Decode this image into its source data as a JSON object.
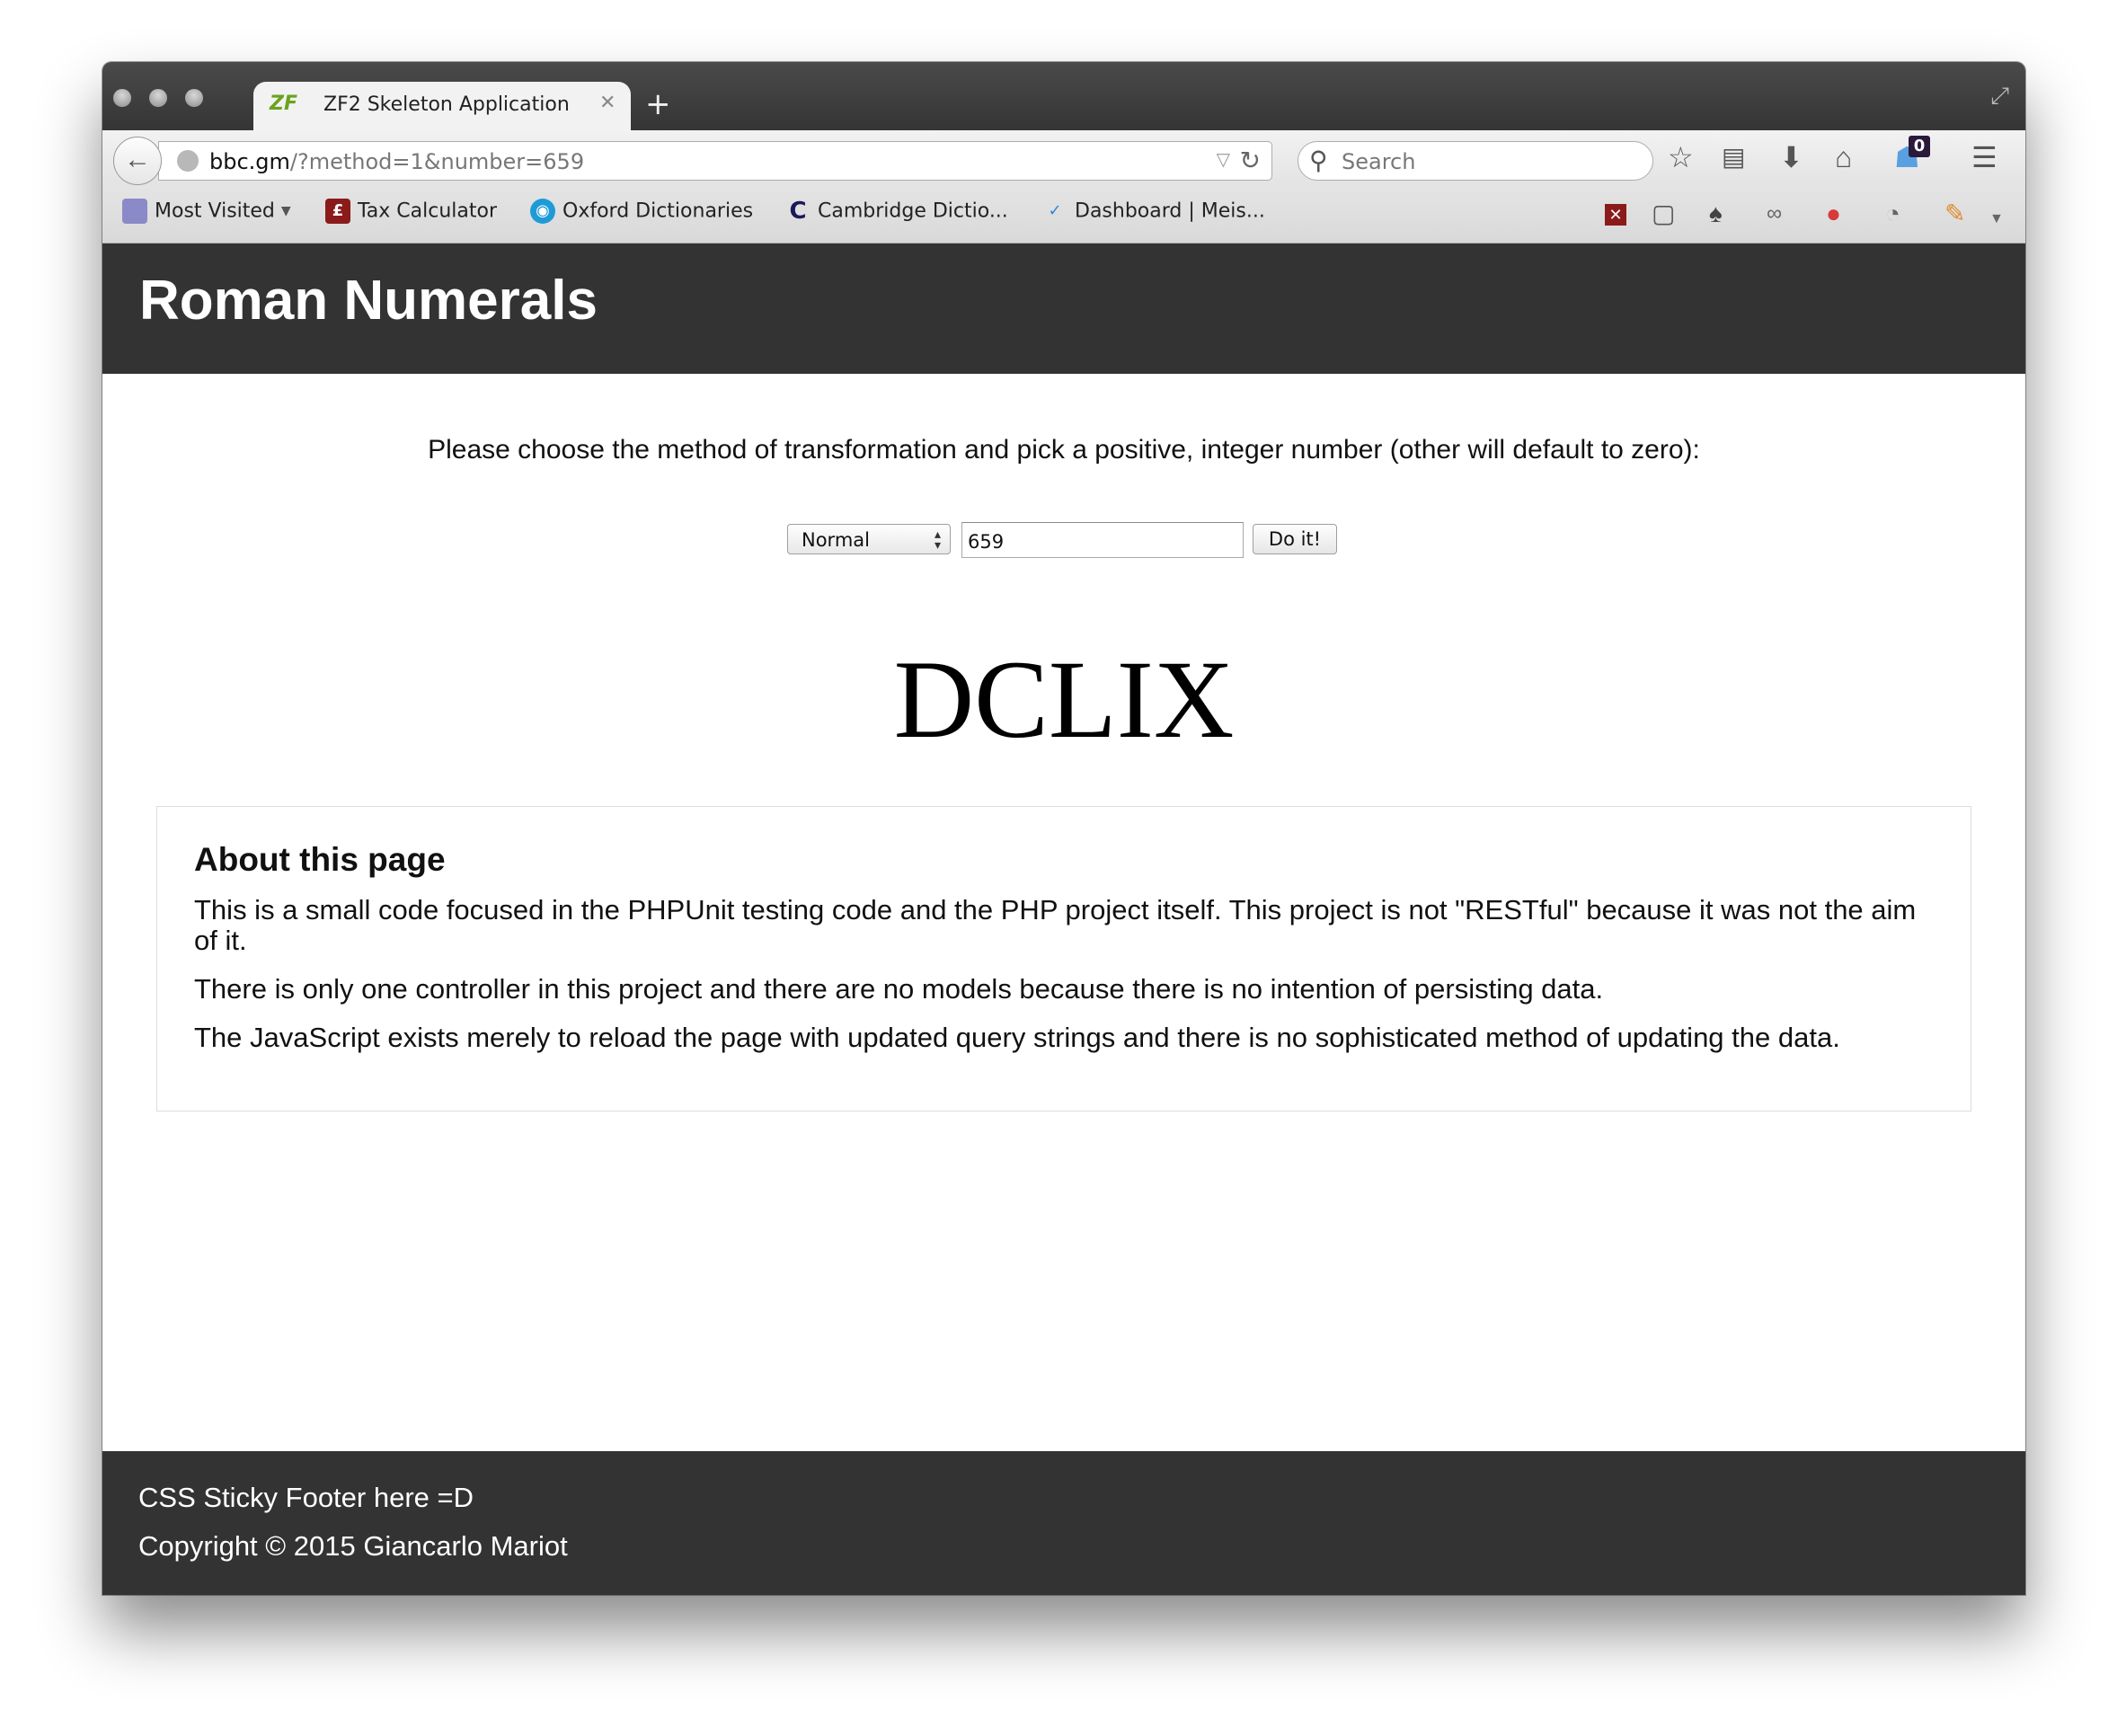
{
  "browser": {
    "tab_title": "ZF2 Skeleton Application",
    "tab_logo_text": "ZF",
    "url_host": "bbc.gm",
    "url_rest": "/?method=1&number=659",
    "search_placeholder": "Search",
    "downloads_badge": "0",
    "bookmarks": [
      {
        "label": "Most Visited",
        "icon": "folder-icon"
      },
      {
        "label": "Tax Calculator",
        "icon": "pound-sign-icon",
        "icon_text": "£"
      },
      {
        "label": "Oxford Dictionaries",
        "icon": "oxford-icon"
      },
      {
        "label": "Cambridge Dictio...",
        "icon": "cambridge-icon",
        "icon_text": "C"
      },
      {
        "label": "Dashboard | Meis...",
        "icon": "check-icon",
        "icon_text": "✓"
      }
    ]
  },
  "page": {
    "header_title": "Roman Numerals",
    "intro": "Please choose the method of transformation and pick a positive, integer number (other will default to zero):",
    "form": {
      "method_selected": "Normal",
      "number_value": "659",
      "submit_label": "Do it!"
    },
    "result": "DCLIX",
    "about": {
      "title": "About this page",
      "paragraphs": [
        "This is a small code focused in the PHPUnit testing code and the PHP project itself. This project is not \"RESTful\" because it was not the aim of it.",
        "There is only one controller in this project and there are no models because there is no intention of persisting data.",
        "The JavaScript exists merely to reload the page with updated query strings and there is no sophisticated method of updating the data."
      ]
    },
    "footer": {
      "line1": "CSS Sticky Footer here =D",
      "line2": "Copyright © 2015 Giancarlo Mariot"
    }
  },
  "colors": {
    "header_bg": "#333333",
    "footer_bg": "#333333",
    "page_bg": "#ffffff",
    "about_border": "#dddddd"
  }
}
